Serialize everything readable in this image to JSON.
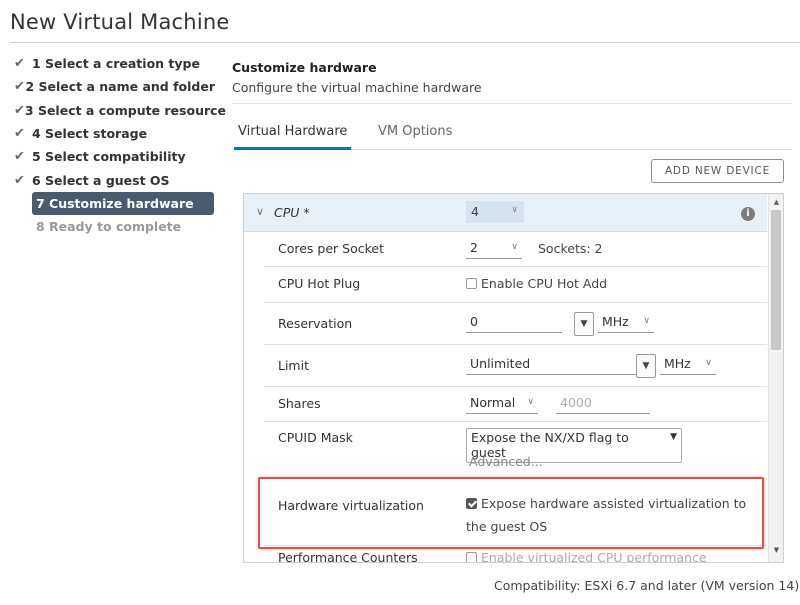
{
  "window": {
    "title": "New Virtual Machine"
  },
  "steps": [
    {
      "label": "1 Select a creation type",
      "state": "done"
    },
    {
      "label": "2 Select a name and folder",
      "state": "done"
    },
    {
      "label": "3 Select a compute resource",
      "state": "done"
    },
    {
      "label": "4 Select storage",
      "state": "done"
    },
    {
      "label": "5 Select compatibility",
      "state": "done"
    },
    {
      "label": "6 Select a guest OS",
      "state": "done"
    },
    {
      "label": "7 Customize hardware",
      "state": "active"
    },
    {
      "label": "8 Ready to complete",
      "state": "pending"
    }
  ],
  "content": {
    "title": "Customize hardware",
    "subtitle": "Configure the virtual machine hardware"
  },
  "tabs": [
    {
      "label": "Virtual Hardware",
      "active": true
    },
    {
      "label": "VM Options",
      "active": false
    }
  ],
  "toolbar": {
    "add_device_label": "ADD NEW DEVICE"
  },
  "cpu": {
    "label": "CPU *",
    "value": "4",
    "info_icon": "info-icon",
    "rows": {
      "cores_per_socket": {
        "label": "Cores per Socket",
        "value": "2",
        "sockets": "Sockets: 2"
      },
      "hot_plug": {
        "label": "CPU Hot Plug",
        "checkbox_label": "Enable CPU Hot Add",
        "checked": false
      },
      "reservation": {
        "label": "Reservation",
        "value": "0",
        "unit": "MHz"
      },
      "limit": {
        "label": "Limit",
        "value": "Unlimited",
        "unit": "MHz"
      },
      "shares": {
        "label": "Shares",
        "value": "Normal",
        "amount": "4000"
      },
      "cpuid": {
        "label": "CPUID Mask",
        "value": "Expose the NX/XD flag to guest",
        "advanced": "Advanced..."
      },
      "hv": {
        "label": "Hardware virtualization",
        "checkbox_line1": "Expose hardware assisted virtualization to",
        "checkbox_line2": "the guest OS",
        "checked": true
      },
      "perf": {
        "label": "Performance Counters",
        "checkbox_label": "Enable virtualized CPU performance"
      }
    }
  },
  "footer": {
    "compatibility": "Compatibility: ESXi 6.7 and later (VM version 14)"
  },
  "colors": {
    "active_step_bg": "#4b5b6e",
    "tab_underline": "#0079b8",
    "highlight": "#d9534f",
    "cpu_header_bg": "#e8f0f7"
  }
}
